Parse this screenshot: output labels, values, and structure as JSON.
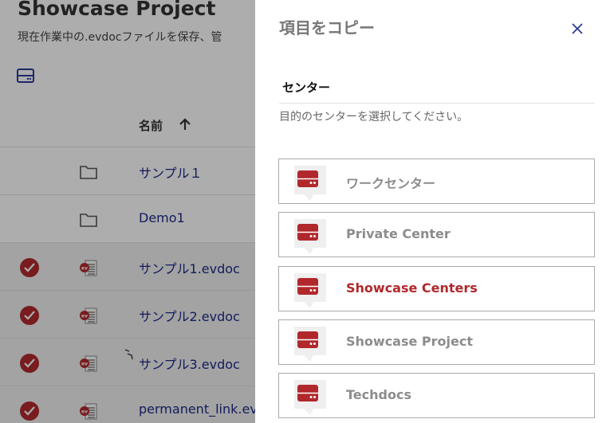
{
  "page": {
    "title": "Showcase Project",
    "subtitle": "現在作業中の.evdocファイルを保存、管",
    "table": {
      "name_header": "名前",
      "rows": [
        {
          "name": "サンプル１",
          "kind": "folder",
          "selected": false
        },
        {
          "name": "Demo1",
          "kind": "folder",
          "selected": false
        },
        {
          "name": "サンプル1.evdoc",
          "kind": "evdoc",
          "selected": true
        },
        {
          "name": "サンプル2.evdoc",
          "kind": "evdoc",
          "selected": true
        },
        {
          "name": "サンプル3.evdoc",
          "kind": "evdoc",
          "selected": true
        },
        {
          "name": "permanent_link.ev",
          "kind": "evdoc",
          "selected": true
        }
      ]
    }
  },
  "drawer": {
    "title": "項目をコピー",
    "section_label": "センター",
    "description": "目的のセンターを選択してください。",
    "centers": [
      {
        "label": "ワークセンター",
        "active": false
      },
      {
        "label": "Private Center",
        "active": false
      },
      {
        "label": "Showcase Centers",
        "active": true
      },
      {
        "label": "Showcase Project",
        "active": false
      },
      {
        "label": "Techdocs",
        "active": false
      }
    ]
  },
  "colors": {
    "accent_red": "#b0282c",
    "link_blue": "#1d2a8a",
    "muted_label": "#8c8c8c"
  },
  "icons": {
    "storage": "storage-icon",
    "sort": "arrow-up-icon",
    "folder": "folder-icon",
    "evdoc": "evdoc-file-icon",
    "check": "check-circle-icon",
    "close": "close-icon",
    "center": "server-center-icon"
  }
}
